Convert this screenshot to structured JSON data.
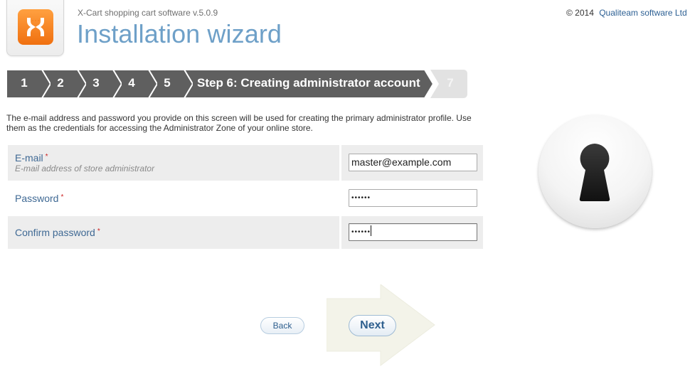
{
  "header": {
    "app_version": "X-Cart shopping cart software v.5.0.9",
    "page_title": "Installation wizard",
    "copyright_prefix": "© 2014",
    "company_link": "Qualiteam software Ltd"
  },
  "steps": [
    {
      "label": "1",
      "state": "done"
    },
    {
      "label": "2",
      "state": "done"
    },
    {
      "label": "3",
      "state": "done"
    },
    {
      "label": "4",
      "state": "done"
    },
    {
      "label": "5",
      "state": "done"
    },
    {
      "label": "Step 6: Creating administrator account",
      "state": "current"
    },
    {
      "label": "7",
      "state": "future"
    }
  ],
  "intro_text": "The e-mail address and password you provide on this screen will be used for creating the primary administrator profile. Use them as the credentials for accessing the Administrator Zone of your online store.",
  "form": {
    "email": {
      "label": "E-mail",
      "required_mark": "*",
      "hint": "E-mail address of store administrator",
      "value": "master@example.com"
    },
    "password": {
      "label": "Password",
      "required_mark": "*",
      "value": "••••••"
    },
    "confirm_password": {
      "label": "Confirm password",
      "required_mark": "*",
      "value": "••••••"
    }
  },
  "buttons": {
    "back": "Back",
    "next": "Next"
  },
  "colors": {
    "step_done": "#5f5f5f",
    "step_current": "#5f5f5f",
    "step_future": "#e2e2e2",
    "title": "#6ea0c8",
    "link": "#2c5f93",
    "logo": "#f58220"
  },
  "icons": {
    "logo": "x-cart-logo-icon",
    "keyhole": "keyhole-icon",
    "arrow": "next-arrow-icon"
  }
}
